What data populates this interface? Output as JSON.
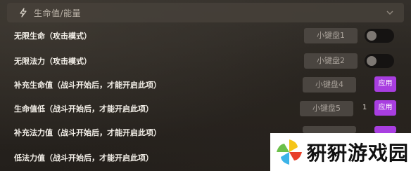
{
  "section": {
    "title": "生命值/能量",
    "icon": "lightning-bolt-icon",
    "chevron": "chevron-down-icon"
  },
  "rows": [
    {
      "label": "无限生命（攻击模式）",
      "key": "小键盘1",
      "control": "toggle",
      "toggle_on": false
    },
    {
      "label": "无限法力（攻击模式）",
      "key": "小键盘2",
      "control": "toggle",
      "toggle_on": false
    },
    {
      "label": "补充生命值（战斗开始后，才能开启此项）",
      "key": "小键盘4",
      "control": "apply",
      "apply_label": "应用"
    },
    {
      "label": "生命值低（战斗开始后，才能开启此项）",
      "key": "小键盘5",
      "control": "apply",
      "apply_label": "应用",
      "value": "1"
    },
    {
      "label": "补充法力值（战斗开始后，才能开启此项）",
      "key": "",
      "control": "apply",
      "apply_label": "应用"
    },
    {
      "label": "低法力值（战斗开始后，才能开启此项）",
      "key": "",
      "control": "none"
    }
  ],
  "watermark": {
    "text": "豣豣游戏园",
    "logo_icon": "pinwheel-logo-icon"
  },
  "colors": {
    "accent": "#a83ee0",
    "panel": "#46413a",
    "key_bg": "#4a4540"
  }
}
